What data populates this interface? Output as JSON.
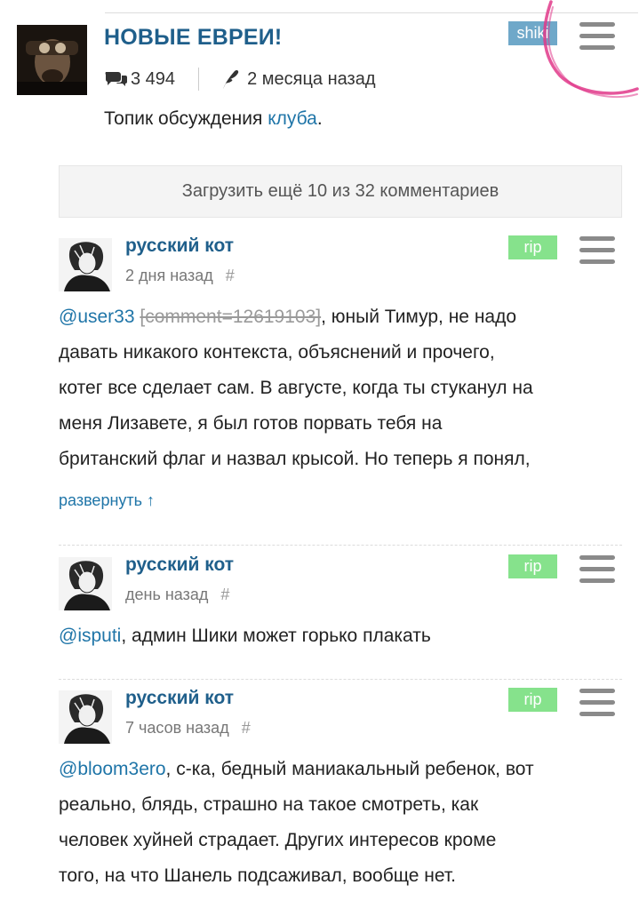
{
  "topic": {
    "title": "НОВЫЕ ЕВРЕИ!",
    "comments_count": "3 494",
    "time_ago": "2 месяца назад",
    "description_prefix": "Топик обсуждения ",
    "description_link": "клуба",
    "description_suffix": ".",
    "badge": "shiki",
    "badge_color": "#6fa8c9",
    "icons": {
      "comments": "comments-icon",
      "author": "quill-icon",
      "menu": "hamburger-menu-icon"
    }
  },
  "load_more": {
    "label": "Загрузить ещё 10 из 32 комментариев"
  },
  "comments": [
    {
      "author": "русский кот",
      "time": "2 дня назад",
      "hash": "#",
      "badge": "rip",
      "mention": "@user33",
      "quote": "[comment=12619103]",
      "lines": [
        ", юный Тимур, не надо",
        "давать никакого контекста, объяснений и прочего,",
        "котег все сделает сам. В августе, когда ты стуканул на",
        "меня Лизавете, я был готов порвать тебя на",
        "британский флаг и назвал крысой. Но теперь я понял,"
      ],
      "expand": "развернуть ↑"
    },
    {
      "author": "русский кот",
      "time": "день назад",
      "hash": "#",
      "badge": "rip",
      "mention": "@isputi",
      "lines": [
        ", админ Шики может горько плакать"
      ]
    },
    {
      "author": "русский кот",
      "time": "7 часов назад",
      "hash": "#",
      "badge": "rip",
      "mention": "@bloom3ero",
      "lines": [
        ", с-ка, бедный маниакальный ребенок, вот",
        "реально, блядь, страшно на такое смотреть, как",
        "человек хуйней страдает. Других интересов кроме",
        "того, на что Шанель подсаживал, вообще нет."
      ]
    }
  ],
  "colors": {
    "link": "#1f75a8",
    "title": "#1f5f8b",
    "rip_badge": "#86e28c",
    "annotation": "#e0388a"
  }
}
